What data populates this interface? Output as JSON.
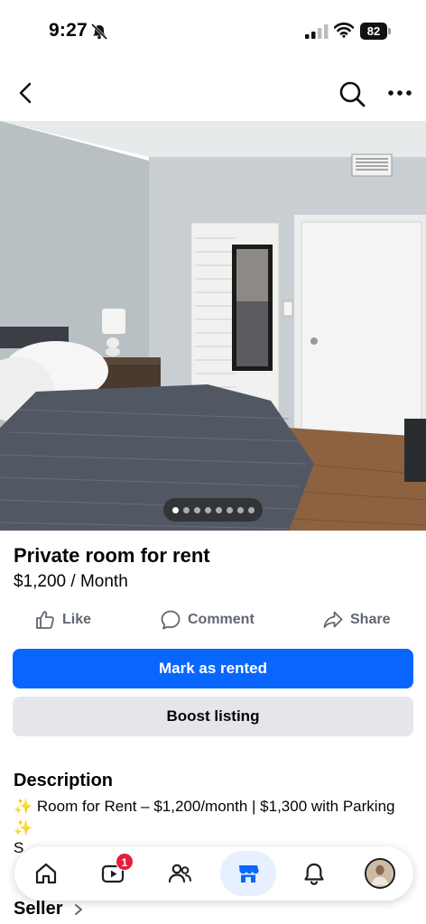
{
  "status_bar": {
    "time": "9:27",
    "battery": "82"
  },
  "listing": {
    "title": "Private room for rent",
    "price": "$1,200 / Month",
    "photo_count": 8,
    "active_photo_index": 0
  },
  "actions": {
    "like": "Like",
    "comment": "Comment",
    "share": "Share"
  },
  "buttons": {
    "mark_rented": "Mark as rented",
    "boost": "Boost listing"
  },
  "description": {
    "heading": "Description",
    "text_before": " Room for Rent – $1,200/month | $1,300 with Parking ",
    "sparkle": "✨",
    "cut_line": "S"
  },
  "seller": {
    "label": "Seller"
  },
  "tabs": {
    "video_badge": "1"
  },
  "colors": {
    "accent": "#0866ff",
    "badge": "#e41e3f",
    "secondary_button": "#e4e6eb"
  }
}
